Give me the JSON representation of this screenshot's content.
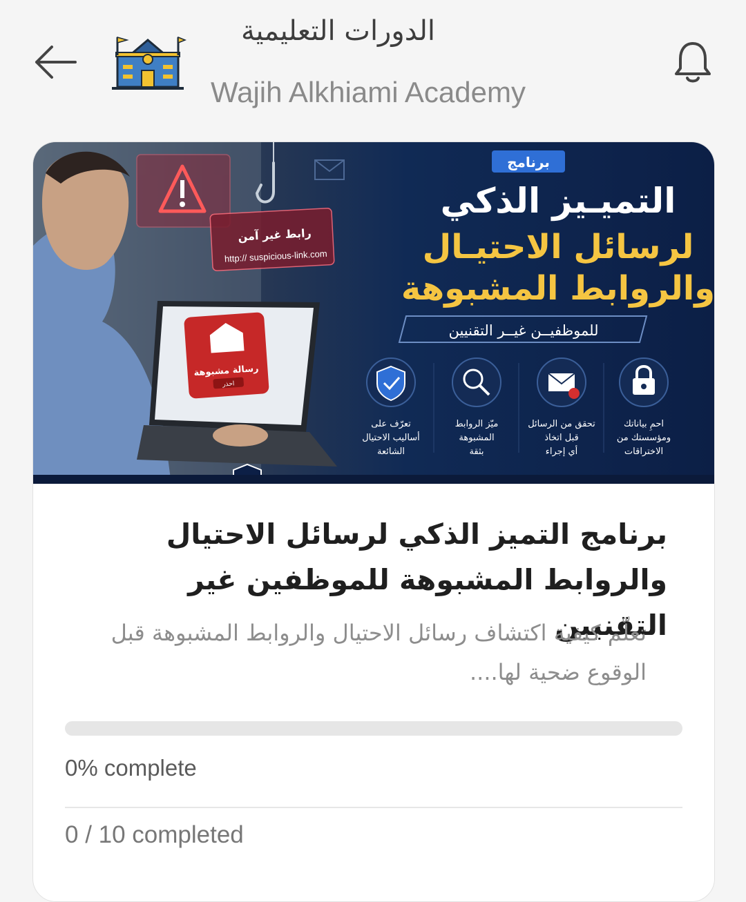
{
  "header": {
    "title": "الدورات التعليمية",
    "subtitle": "Wajih Alkhiami Academy",
    "back_icon": "arrow-left-icon",
    "bell_icon": "bell-icon",
    "logo_icon": "academy-building-logo"
  },
  "banner": {
    "tag": "برنامج",
    "headline_1": "التميـيز الذكي",
    "headline_2": "لرسائل الاحتيـال",
    "headline_3": "والروابط المشبوهة",
    "audience": "للموظفيــن غيــر التقنيين",
    "warning_title": "رابط غير آمن",
    "warning_url": "http:// suspicious-link.com",
    "alert_title": "رسالة مشبوهة",
    "alert_button": "احذر",
    "features": [
      {
        "icon": "shield-check-icon",
        "line1": "تعرّف على",
        "line2": "أساليب الاحتيال",
        "line3": "الشائعة"
      },
      {
        "icon": "magnifier-icon",
        "line1": "ميّز الروابط",
        "line2": "المشبوهة",
        "line3": "بثقة"
      },
      {
        "icon": "mail-alert-icon",
        "line1": "تحقق من الرسائل",
        "line2": "قبل اتخاذ",
        "line3": "أي إجراء"
      },
      {
        "icon": "lock-icon",
        "line1": "احمِ بياناتك",
        "line2": "ومؤسستك من",
        "line3": "الاختراقات"
      }
    ]
  },
  "course": {
    "title": "برنامج التميز الذكي لرسائل الاحتيال والروابط المشبوهة للموظفين غير التقنيين",
    "description": "تعلّم كيفية اكتشاف رسائل الاحتيال والروابط المشبوهة قبل الوقوع ضحية لها....",
    "progress_percent": 0,
    "progress_label": "0% complete",
    "completed_label": "0 / 10 completed"
  },
  "colors": {
    "accent_gold": "#f5c542",
    "banner_navy": "#0c1f46",
    "alert_red": "#d32f2f",
    "tag_blue": "#2f6fd6"
  }
}
